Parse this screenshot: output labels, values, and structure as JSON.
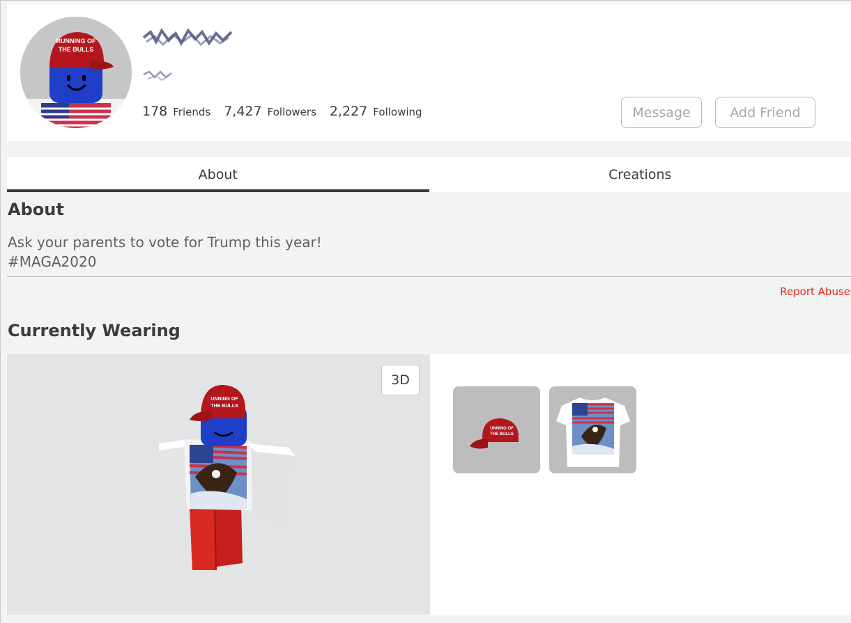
{
  "profile": {
    "stats": [
      {
        "count": "178",
        "label": "Friends"
      },
      {
        "count": "7,427",
        "label": "Followers"
      },
      {
        "count": "2,227",
        "label": "Following"
      }
    ],
    "message_label": "Message",
    "add_friend_label": "Add Friend",
    "hat_text_line1": "RUNNING OF",
    "hat_text_line2": "THE BULLS"
  },
  "tabs": [
    {
      "label": "About",
      "active": true
    },
    {
      "label": "Creations",
      "active": false
    }
  ],
  "about": {
    "title": "About",
    "line1": "Ask your parents to vote for Trump this year!",
    "line2": "#MAGA2020",
    "report_label": "Report Abuse"
  },
  "wearing": {
    "title": "Currently Wearing",
    "view_toggle_label": "3D",
    "hat_text_line1": "UNNING OF",
    "hat_text_line2": "THE BULLS"
  },
  "colors": {
    "accent_red": "#e2231a",
    "text_primary": "#393b3d",
    "hat_red": "#b3161c",
    "head_blue": "#1e3fcc"
  }
}
